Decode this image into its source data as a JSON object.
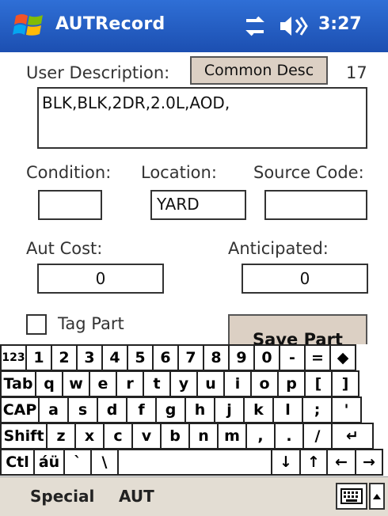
{
  "titlebar": {
    "app_title": "AUTRecord",
    "time": "3:27",
    "icons": [
      "windows-start-icon",
      "connectivity-icon",
      "speaker-icon"
    ]
  },
  "form": {
    "user_description_label": "User Description:",
    "common_desc_button": "Common Desc",
    "char_count": "17",
    "description_value": "BLK,BLK,2DR,2.0L,AOD,",
    "condition_label": "Condition:",
    "location_label": "Location:",
    "source_code_label": "Source Code:",
    "condition_value": "",
    "location_value": "YARD",
    "source_code_value": "",
    "aut_cost_label": "Aut Cost:",
    "anticipated_label": "Anticipated:",
    "aut_cost_value": "0",
    "anticipated_value": "0",
    "tag_part_label": "Tag Part",
    "tag_part_checked": false,
    "save_part_button": "Save Part"
  },
  "keyboard": {
    "rows": [
      [
        "123",
        "1",
        "2",
        "3",
        "4",
        "5",
        "6",
        "7",
        "8",
        "9",
        "0",
        "-",
        "=",
        "◆"
      ],
      [
        "Tab",
        "q",
        "w",
        "e",
        "r",
        "t",
        "y",
        "u",
        "i",
        "o",
        "p",
        "[",
        "]"
      ],
      [
        "CAP",
        "a",
        "s",
        "d",
        "f",
        "g",
        "h",
        "j",
        "k",
        "l",
        ";",
        "'"
      ],
      [
        "Shift",
        "z",
        "x",
        "c",
        "v",
        "b",
        "n",
        "m",
        ",",
        ".",
        "/",
        "↵"
      ],
      [
        "Ctl",
        "áü",
        "`",
        "\\",
        " ",
        "↓",
        "↑",
        "←",
        "→"
      ]
    ]
  },
  "menubar": {
    "left": "Special",
    "right": "AUT",
    "keyboard_icon": "keyboard-icon",
    "arrow_icon": "up-arrow-icon"
  }
}
